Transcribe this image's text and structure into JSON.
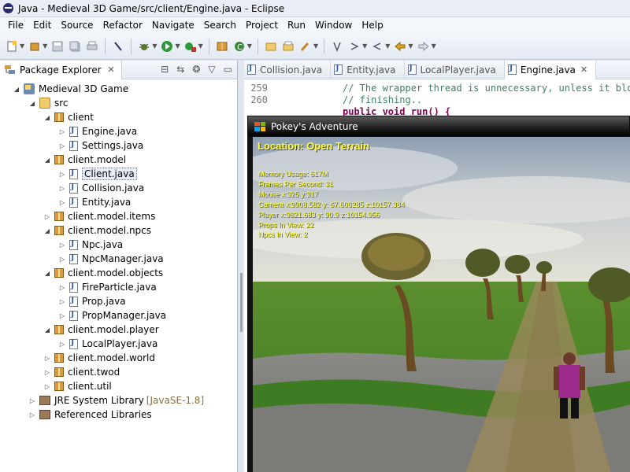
{
  "window": {
    "title": "Java - Medieval 3D Game/src/client/Engine.java - Eclipse"
  },
  "menu": [
    "File",
    "Edit",
    "Source",
    "Refactor",
    "Navigate",
    "Search",
    "Project",
    "Run",
    "Window",
    "Help"
  ],
  "explorer": {
    "tab_label": "Package Explorer",
    "tree": [
      {
        "label": "Medieval 3D Game",
        "icon": "project-icon",
        "depth": 0,
        "twisty": "expanded"
      },
      {
        "label": "src",
        "icon": "source-folder-icon",
        "depth": 1,
        "twisty": "expanded"
      },
      {
        "label": "client",
        "icon": "package-icon",
        "depth": 2,
        "twisty": "expanded"
      },
      {
        "label": "Engine.java",
        "icon": "java-file-icon",
        "depth": 3,
        "twisty": "collapsed"
      },
      {
        "label": "Settings.java",
        "icon": "java-file-icon",
        "depth": 3,
        "twisty": "collapsed"
      },
      {
        "label": "client.model",
        "icon": "package-icon",
        "depth": 2,
        "twisty": "expanded"
      },
      {
        "label": "Client.java",
        "icon": "java-file-icon",
        "depth": 3,
        "twisty": "collapsed",
        "selected": true
      },
      {
        "label": "Collision.java",
        "icon": "java-file-icon",
        "depth": 3,
        "twisty": "collapsed"
      },
      {
        "label": "Entity.java",
        "icon": "java-file-icon",
        "depth": 3,
        "twisty": "collapsed"
      },
      {
        "label": "client.model.items",
        "icon": "package-icon",
        "depth": 2,
        "twisty": "collapsed"
      },
      {
        "label": "client.model.npcs",
        "icon": "package-icon",
        "depth": 2,
        "twisty": "expanded"
      },
      {
        "label": "Npc.java",
        "icon": "java-file-icon",
        "depth": 3,
        "twisty": "collapsed"
      },
      {
        "label": "NpcManager.java",
        "icon": "java-file-icon",
        "depth": 3,
        "twisty": "collapsed"
      },
      {
        "label": "client.model.objects",
        "icon": "package-icon",
        "depth": 2,
        "twisty": "expanded"
      },
      {
        "label": "FireParticle.java",
        "icon": "java-file-icon",
        "depth": 3,
        "twisty": "collapsed"
      },
      {
        "label": "Prop.java",
        "icon": "java-file-icon",
        "depth": 3,
        "twisty": "collapsed"
      },
      {
        "label": "PropManager.java",
        "icon": "java-file-icon",
        "depth": 3,
        "twisty": "collapsed"
      },
      {
        "label": "client.model.player",
        "icon": "package-icon",
        "depth": 2,
        "twisty": "expanded"
      },
      {
        "label": "LocalPlayer.java",
        "icon": "java-file-icon",
        "depth": 3,
        "twisty": "collapsed"
      },
      {
        "label": "client.model.world",
        "icon": "package-icon",
        "depth": 2,
        "twisty": "collapsed"
      },
      {
        "label": "client.twod",
        "icon": "package-icon",
        "depth": 2,
        "twisty": "collapsed"
      },
      {
        "label": "client.util",
        "icon": "package-icon",
        "depth": 2,
        "twisty": "collapsed"
      },
      {
        "label": "JRE System Library",
        "suffix": "[JavaSE-1.8]",
        "icon": "library-icon",
        "depth": 1,
        "twisty": "collapsed"
      },
      {
        "label": "Referenced Libraries",
        "icon": "library-icon",
        "depth": 1,
        "twisty": "collapsed"
      }
    ]
  },
  "editor": {
    "tabs": [
      {
        "label": "Collision.java",
        "active": false
      },
      {
        "label": "Entity.java",
        "active": false
      },
      {
        "label": "LocalPlayer.java",
        "active": false
      },
      {
        "label": "Engine.java",
        "active": true
      }
    ],
    "lines": [
      {
        "number": "259",
        "text": "// The wrapper thread is unnecessary, unless it bloc",
        "kind": "comment"
      },
      {
        "number": "260",
        "text": "// finishing..",
        "kind": "comment"
      },
      {
        "number": "",
        "text": "public void run() {",
        "kind": "code"
      }
    ]
  },
  "game": {
    "title": "Pokey's Adventure",
    "location": "Location: Open Terrain",
    "stats": [
      "Memory Usage: 617M",
      "Frames Per Second: 31",
      "Mouse x:325 y:317",
      "Camera x:9908.582 y: 67.606285 z:10157.384",
      "Player x:9821.683 y: 90.9 z:10154.956",
      "Props In View: 22",
      "Npcs In View: 2"
    ]
  }
}
